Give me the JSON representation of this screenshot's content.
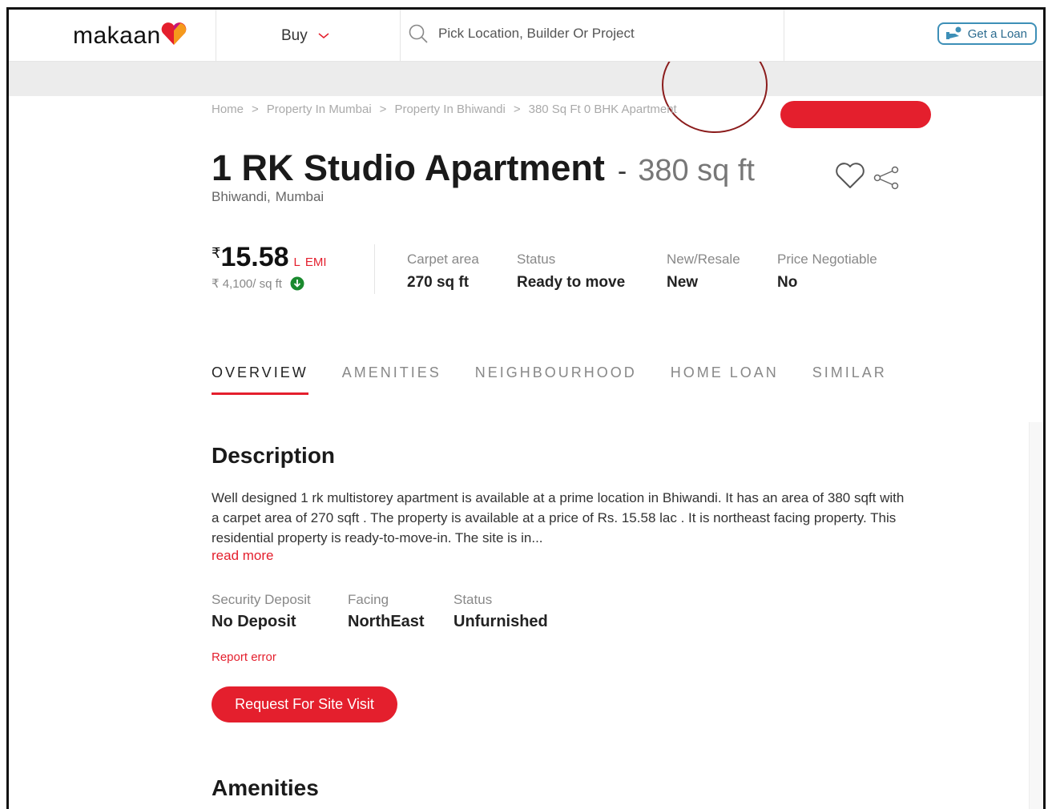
{
  "header": {
    "logo_text": "makaan",
    "buy_label": "Buy",
    "search_placeholder": "Pick Location, Builder Or Project",
    "loan_label": "Get a Loan"
  },
  "breadcrumb": [
    "Home",
    "Property In Mumbai",
    "Property In Bhiwandi",
    "380 Sq Ft 0 BHK Apartment"
  ],
  "breadcrumb_separator": ">",
  "listing": {
    "title": "1 RK Studio Apartment",
    "dash": "-",
    "area": "380 sq ft",
    "locality": "Bhiwandi,",
    "city": "Mumbai"
  },
  "price": {
    "currency": "₹",
    "value": "15.58",
    "unit": "L",
    "emi_label": "EMI",
    "per_sqft": "₹ 4,100/ sq ft"
  },
  "facts": [
    {
      "label": "Carpet area",
      "value": "270 sq ft"
    },
    {
      "label": "Status",
      "value": "Ready to move"
    },
    {
      "label": "New/Resale",
      "value": "New"
    },
    {
      "label": "Price Negotiable",
      "value": "No"
    }
  ],
  "tabs": [
    {
      "label": "OVERVIEW",
      "active": true
    },
    {
      "label": "AMENITIES",
      "active": false
    },
    {
      "label": "NEIGHBOURHOOD",
      "active": false
    },
    {
      "label": "HOME LOAN",
      "active": false
    },
    {
      "label": "SIMILAR",
      "active": false
    }
  ],
  "description": {
    "heading": "Description",
    "text": "Well designed 1 rk multistorey apartment is available at a prime location in Bhiwandi. It has an area of 380 sqft with a carpet area of 270 sqft . The property is available at a price of Rs. 15.58 lac . It is northeast facing property. This residential property is ready-to-move-in. The site is in...",
    "read_more": "read more",
    "details": [
      {
        "label": "Security Deposit",
        "value": "No Deposit"
      },
      {
        "label": "Facing",
        "value": "NorthEast"
      },
      {
        "label": "Status",
        "value": "Unfurnished"
      }
    ],
    "report_error": "Report error",
    "site_visit_button": "Request For Site Visit"
  },
  "amenities_heading": "Amenities",
  "colors": {
    "accent": "#e41f2d",
    "loan_border": "#3d8fb7"
  }
}
